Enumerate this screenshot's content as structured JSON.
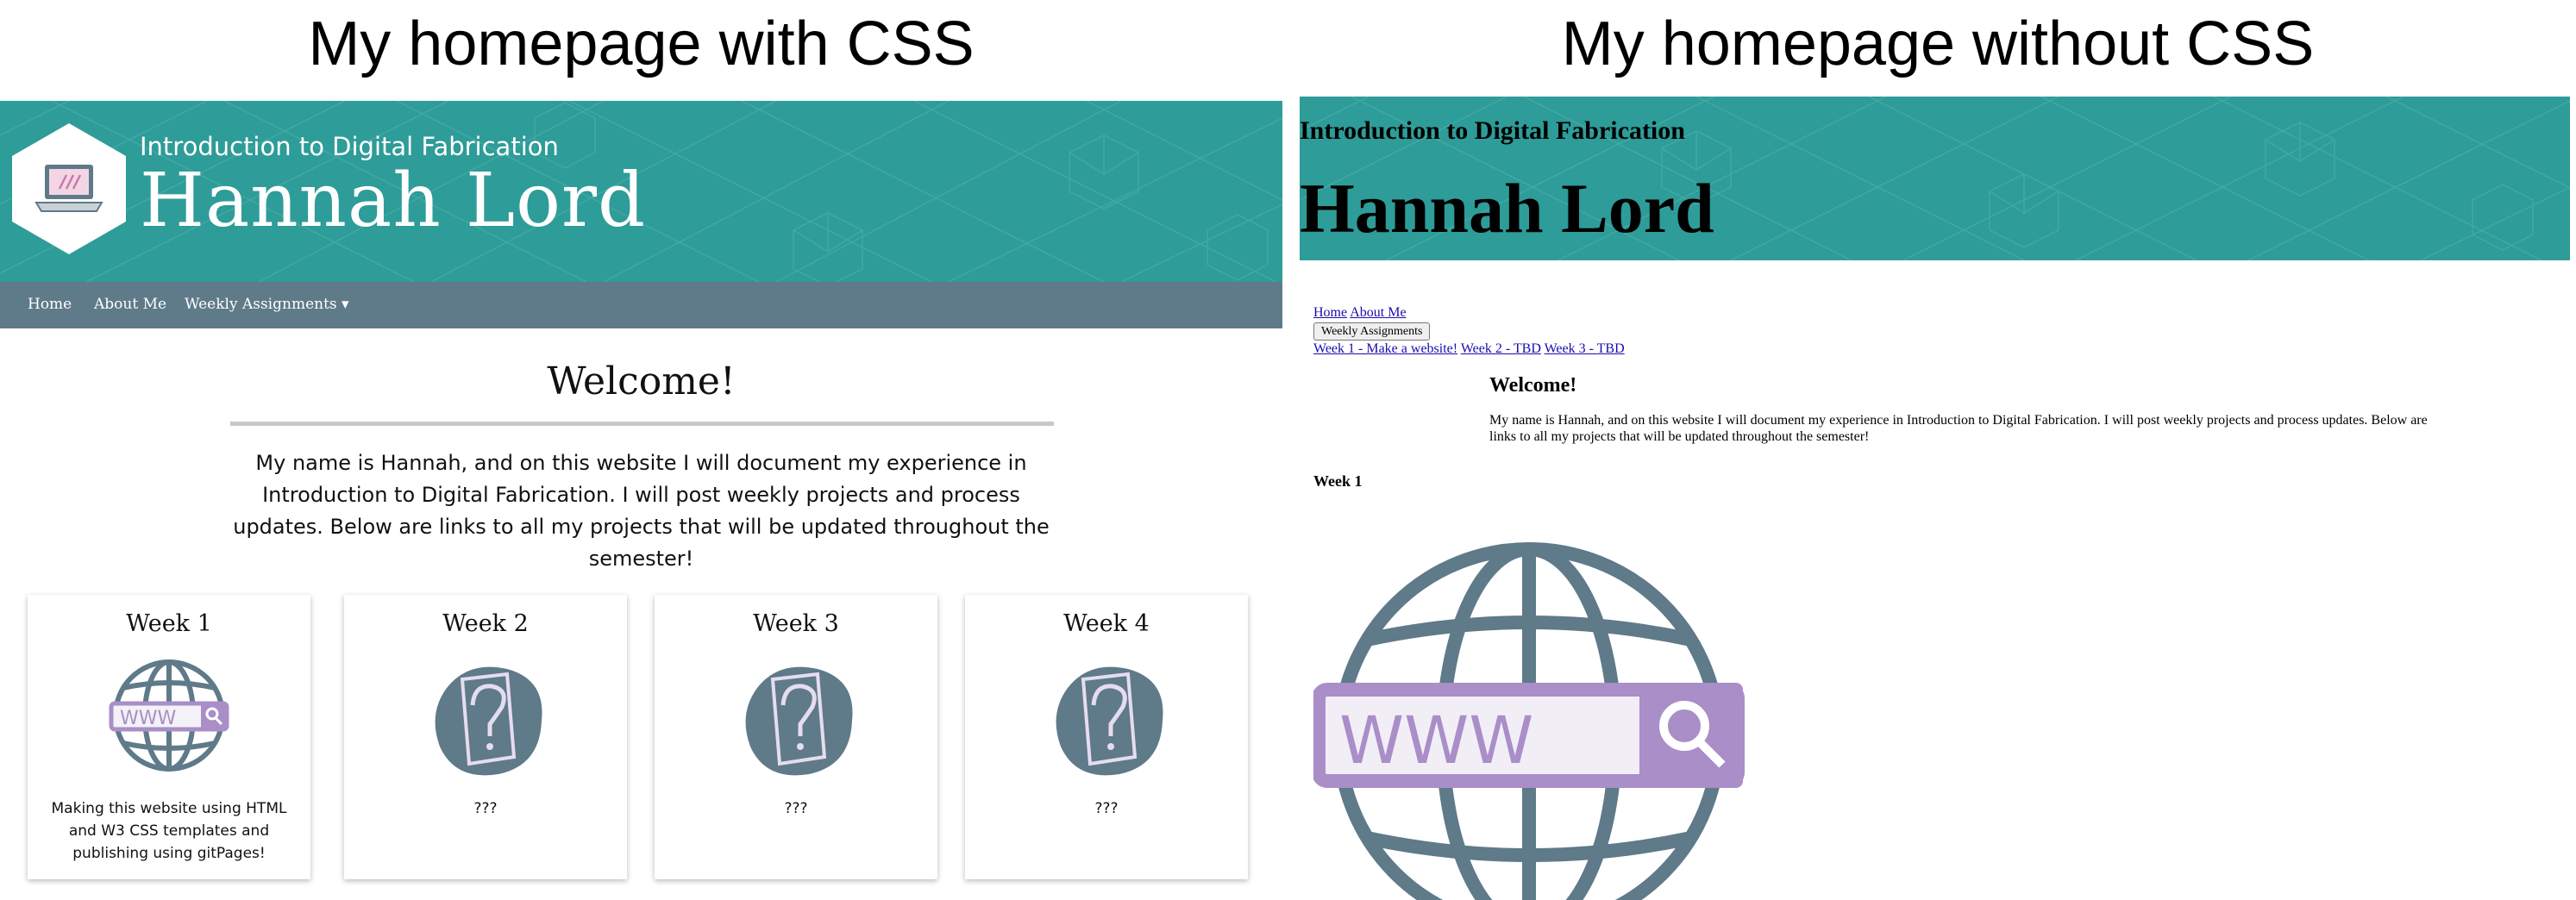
{
  "panel_titles": {
    "left": "My homepage with CSS",
    "right": "My homepage without CSS"
  },
  "styled_page": {
    "subtitle": "Introduction to Digital Fabrication",
    "name": "Hannah Lord",
    "nav": {
      "home": "Home",
      "about": "About Me",
      "weekly": "Weekly Assignments ▾"
    },
    "welcome": "Welcome!",
    "intro": "My name is Hannah, and on this website I will document my experience in Introduction to Digital Fabrication. I will post weekly projects and process updates. Below are links to all my projects that will be updated throughout the semester!",
    "cards": [
      {
        "title": "Week 1",
        "icon": "www-globe-icon",
        "desc": "Making this website using HTML and W3 CSS templates and publishing using gitPages!"
      },
      {
        "title": "Week 2",
        "icon": "question-paper-icon",
        "desc": "???"
      },
      {
        "title": "Week 3",
        "icon": "question-paper-icon",
        "desc": "???"
      },
      {
        "title": "Week 4",
        "icon": "question-paper-icon",
        "desc": "???"
      }
    ]
  },
  "unstyled_page": {
    "subtitle": "Introduction to Digital Fabrication",
    "name": "Hannah Lord",
    "links": {
      "home": "Home",
      "about": "About Me",
      "weekly_button": "Weekly Assignments",
      "week1": "Week 1 - Make a website!",
      "week2": "Week 2 - TBD",
      "week3": "Week 3 - TBD"
    },
    "welcome": "Welcome!",
    "intro": "My name is Hannah, and on this website I will document my experience in Introduction to Digital Fabrication. I will post weekly projects and process updates. Below are links to all my projects that will be updated throughout the semester!",
    "week_heading": "Week 1",
    "image_icon": "www-globe-icon"
  },
  "colors": {
    "banner_teal": "#2e9c98",
    "nav_slate": "#5f7a89",
    "globe_slate": "#5f7a89",
    "www_purple": "#a98ec8",
    "blob_slate": "#5f7a89"
  }
}
